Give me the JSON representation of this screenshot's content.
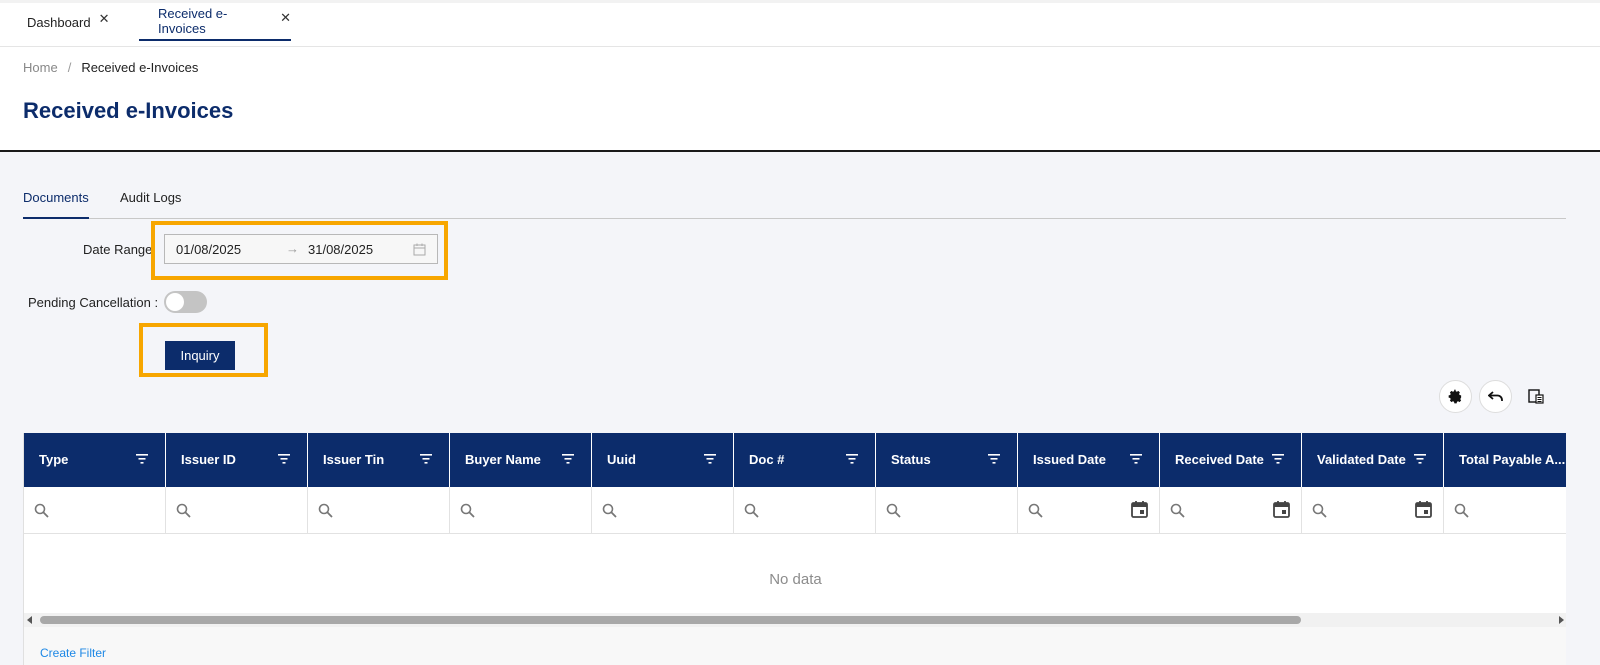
{
  "tabs": [
    {
      "label": "Dashboard",
      "close": "✕"
    },
    {
      "label": "Received e-Invoices",
      "close": "✕"
    }
  ],
  "breadcrumb": {
    "home": "Home",
    "separator": "/",
    "current": "Received e-Invoices"
  },
  "page_title": "Received e-Invoices",
  "subtabs": [
    {
      "label": "Documents"
    },
    {
      "label": "Audit Logs"
    }
  ],
  "filters": {
    "date_range_label": "Date Range",
    "date_from": "01/08/2025",
    "date_arrow": "→",
    "date_to": "31/08/2025",
    "pending_label": "Pending Cancellation :",
    "pending_on": false,
    "inquiry_label": "Inquiry"
  },
  "grid": {
    "columns": [
      {
        "label": "Type"
      },
      {
        "label": "Issuer ID"
      },
      {
        "label": "Issuer Tin"
      },
      {
        "label": "Buyer Name"
      },
      {
        "label": "Uuid"
      },
      {
        "label": "Doc #"
      },
      {
        "label": "Status"
      },
      {
        "label": "Issued Date"
      },
      {
        "label": "Received Date"
      },
      {
        "label": "Validated Date"
      },
      {
        "label": "Total Payable A..."
      }
    ],
    "empty_text": "No data",
    "create_filter": "Create Filter"
  },
  "colors": {
    "primary": "#0c2c6b",
    "highlight": "#f7a600",
    "link": "#1e88e5"
  }
}
